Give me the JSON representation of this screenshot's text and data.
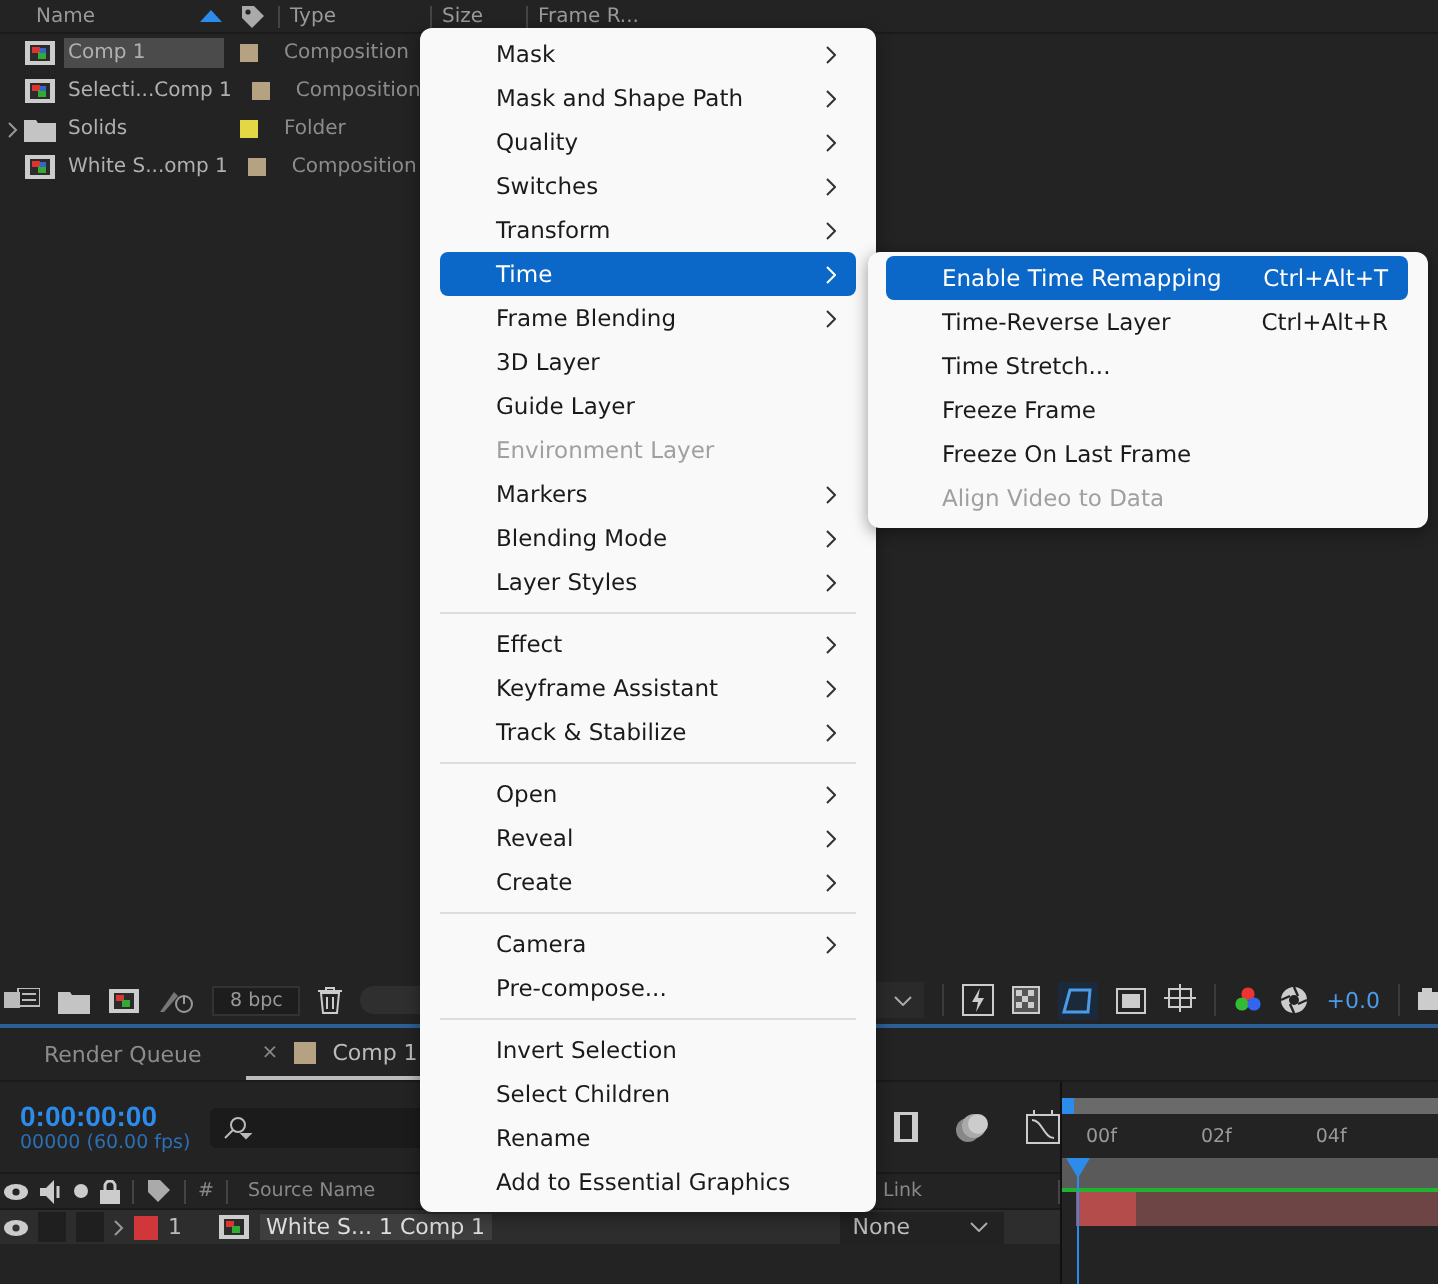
{
  "project": {
    "columns": [
      "Name",
      "Type",
      "Size",
      "Frame R..."
    ],
    "items": [
      {
        "name": "Comp 1",
        "type": "Composition",
        "kind": "comp",
        "color": "#b5a282",
        "selected": true
      },
      {
        "name": "Selecti...Comp 1",
        "type": "Composition",
        "kind": "comp",
        "color": "#b5a282",
        "selected": false
      },
      {
        "name": "Solids",
        "type": "Folder",
        "kind": "folder",
        "color": "#e3d745",
        "selected": false
      },
      {
        "name": "White S...omp 1",
        "type": "Composition",
        "kind": "comp",
        "color": "#b5a282",
        "selected": false
      }
    ]
  },
  "toolbar": {
    "bpc": "8 bpc",
    "exposure": "+0.0"
  },
  "tabs": [
    {
      "label": "Render Queue",
      "selected": false
    },
    {
      "label": "Comp 1",
      "selected": true,
      "close": "×",
      "color": "#b5a282"
    }
  ],
  "timeline": {
    "timecode": "0:00:00:00",
    "fps": "00000 (60.00 fps)",
    "columns": [
      "#",
      "Source Name",
      "Link"
    ],
    "layers": [
      {
        "index": "1",
        "name": "White S... 1 Comp 1",
        "color": "#d0373a",
        "link": "None"
      }
    ],
    "ruler": [
      "00f",
      "02f",
      "04f"
    ]
  },
  "context_menu": [
    {
      "kind": "item",
      "label": "Mask",
      "submenu": true,
      "disabled": false,
      "selected": false
    },
    {
      "kind": "item",
      "label": "Mask and Shape Path",
      "submenu": true,
      "disabled": false,
      "selected": false
    },
    {
      "kind": "item",
      "label": "Quality",
      "submenu": true,
      "disabled": false,
      "selected": false
    },
    {
      "kind": "item",
      "label": "Switches",
      "submenu": true,
      "disabled": false,
      "selected": false
    },
    {
      "kind": "item",
      "label": "Transform",
      "submenu": true,
      "disabled": false,
      "selected": false
    },
    {
      "kind": "item",
      "label": "Time",
      "submenu": true,
      "disabled": false,
      "selected": true
    },
    {
      "kind": "item",
      "label": "Frame Blending",
      "submenu": true,
      "disabled": false,
      "selected": false
    },
    {
      "kind": "item",
      "label": "3D Layer",
      "submenu": false,
      "disabled": false,
      "selected": false
    },
    {
      "kind": "item",
      "label": "Guide Layer",
      "submenu": false,
      "disabled": false,
      "selected": false
    },
    {
      "kind": "item",
      "label": "Environment Layer",
      "submenu": false,
      "disabled": true,
      "selected": false
    },
    {
      "kind": "item",
      "label": "Markers",
      "submenu": true,
      "disabled": false,
      "selected": false
    },
    {
      "kind": "item",
      "label": "Blending Mode",
      "submenu": true,
      "disabled": false,
      "selected": false
    },
    {
      "kind": "item",
      "label": "Layer Styles",
      "submenu": true,
      "disabled": false,
      "selected": false
    },
    {
      "kind": "separator"
    },
    {
      "kind": "item",
      "label": "Effect",
      "submenu": true,
      "disabled": false,
      "selected": false
    },
    {
      "kind": "item",
      "label": "Keyframe Assistant",
      "submenu": true,
      "disabled": false,
      "selected": false
    },
    {
      "kind": "item",
      "label": "Track & Stabilize",
      "submenu": true,
      "disabled": false,
      "selected": false
    },
    {
      "kind": "separator"
    },
    {
      "kind": "item",
      "label": "Open",
      "submenu": true,
      "disabled": false,
      "selected": false
    },
    {
      "kind": "item",
      "label": "Reveal",
      "submenu": true,
      "disabled": false,
      "selected": false
    },
    {
      "kind": "item",
      "label": "Create",
      "submenu": true,
      "disabled": false,
      "selected": false
    },
    {
      "kind": "separator"
    },
    {
      "kind": "item",
      "label": "Camera",
      "submenu": true,
      "disabled": false,
      "selected": false
    },
    {
      "kind": "item",
      "label": "Pre-compose...",
      "submenu": false,
      "disabled": false,
      "selected": false
    },
    {
      "kind": "separator"
    },
    {
      "kind": "item",
      "label": "Invert Selection",
      "submenu": false,
      "disabled": false,
      "selected": false
    },
    {
      "kind": "item",
      "label": "Select Children",
      "submenu": false,
      "disabled": false,
      "selected": false
    },
    {
      "kind": "item",
      "label": "Rename",
      "submenu": false,
      "disabled": false,
      "selected": false
    },
    {
      "kind": "item",
      "label": "Add to Essential Graphics",
      "submenu": false,
      "disabled": false,
      "selected": false
    }
  ],
  "submenu": [
    {
      "label": "Enable Time Remapping",
      "shortcut": "Ctrl+Alt+T",
      "disabled": false,
      "selected": true
    },
    {
      "label": "Time-Reverse Layer",
      "shortcut": "Ctrl+Alt+R",
      "disabled": false,
      "selected": false
    },
    {
      "label": "Time Stretch...",
      "disabled": false,
      "selected": false
    },
    {
      "label": "Freeze Frame",
      "disabled": false,
      "selected": false
    },
    {
      "label": "Freeze On Last Frame",
      "disabled": false,
      "selected": false
    },
    {
      "label": "Align Video to Data",
      "disabled": true,
      "selected": false
    }
  ]
}
